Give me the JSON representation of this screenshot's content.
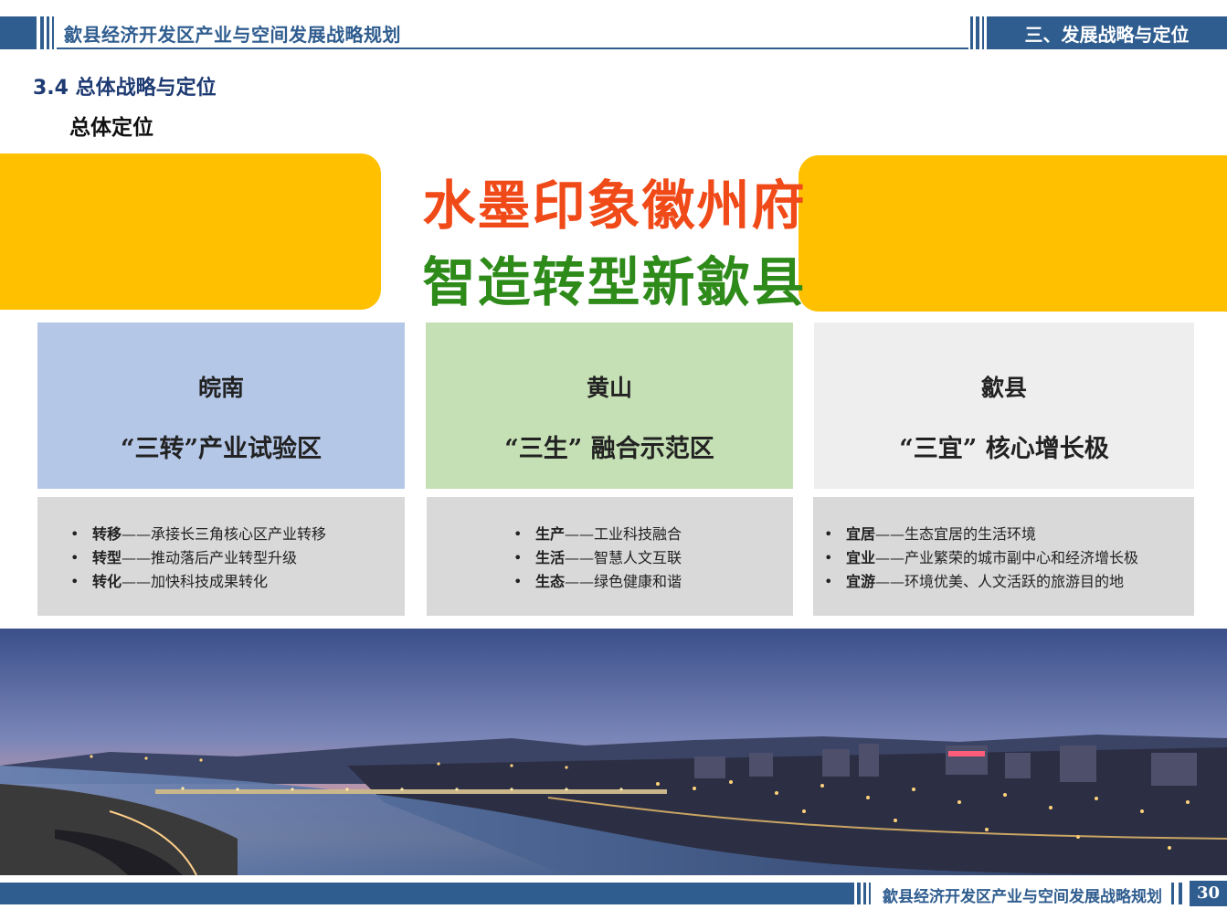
{
  "header": {
    "title": "歙县经济开发区产业与空间发展战略规划",
    "section": "三、发展战略与定位"
  },
  "section_title": "3.4 总体战略与定位",
  "subsection_title": "总体定位",
  "slogan": {
    "line1": "水墨印象徽州府",
    "line2": "智造转型新歙县"
  },
  "cards": [
    {
      "title": "皖南",
      "subtitle": "“三转”产业试验区",
      "color": "#b4c7e7",
      "items": [
        {
          "key": "转移",
          "text": "——承接长三角核心区产业转移"
        },
        {
          "key": "转型",
          "text": "——推动落后产业转型升级"
        },
        {
          "key": "转化",
          "text": "——加快科技成果转化"
        }
      ]
    },
    {
      "title": "黄山",
      "subtitle": "“三生” 融合示范区",
      "color": "#c5e0b4",
      "items": [
        {
          "key": "生产",
          "text": "——工业科技融合"
        },
        {
          "key": "生活",
          "text": "——智慧人文互联"
        },
        {
          "key": "生态",
          "text": "——绿色健康和谐"
        }
      ]
    },
    {
      "title": "歙县",
      "subtitle": "“三宜” 核心增长极",
      "color": "#eeeeee",
      "items": [
        {
          "key": "宜居",
          "text": "——生态宜居的生活环境"
        },
        {
          "key": "宜业",
          "text": "——产业繁荣的城市副中心和经济增长极"
        },
        {
          "key": "宜游",
          "text": "——环境优美、人文活跃的旅游目的地"
        }
      ]
    }
  ],
  "footer": {
    "title": "歙县经济开发区产业与空间发展战略规划",
    "page": "30"
  },
  "colors": {
    "brand_blue": "#2f5d8f",
    "yellow": "#ffc000",
    "slogan_red": "#f04a19",
    "slogan_green": "#2e8b1a"
  }
}
